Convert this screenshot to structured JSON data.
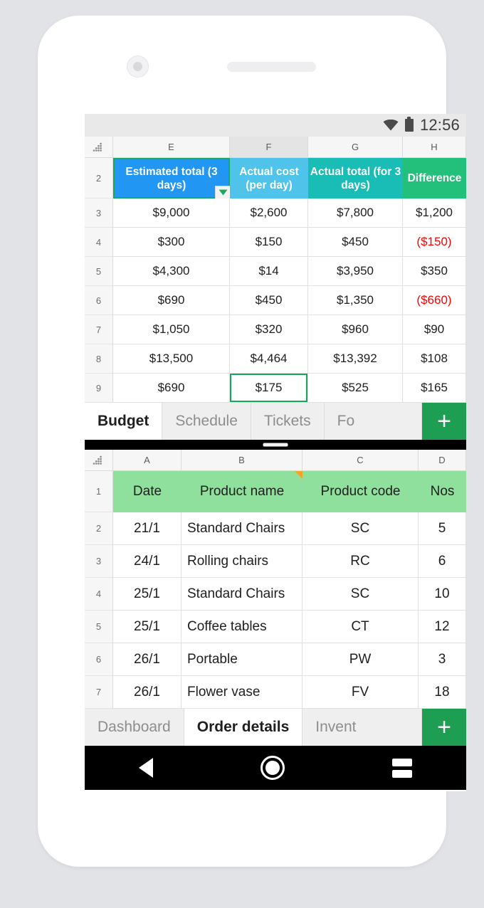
{
  "status_bar": {
    "time": "12:56",
    "wifi_icon": "wifi-icon",
    "battery_icon": "battery-full-icon"
  },
  "colors": {
    "accent_green": "#1e9e52",
    "header_blue": "#2196f3",
    "header_lightblue": "#4fc3e9",
    "header_teal": "#1abdb5",
    "header_green": "#22c07a",
    "row1_green": "#8ee09c",
    "negative_red": "#ff0000",
    "selection_green": "#15a85f",
    "note_flag_orange": "#f5a623"
  },
  "top_sheet": {
    "name": "Budget",
    "corner_icon": "select-all-icon",
    "column_headers": [
      "E",
      "F",
      "G",
      "H"
    ],
    "active_column": "F",
    "header_row_number": "2",
    "header_cells": [
      {
        "text": "Estimated total (3 days)",
        "color": "#2196f3",
        "selected": true
      },
      {
        "text": "Actual cost (per day)",
        "color": "#4fc3e9",
        "selected": false
      },
      {
        "text": "Actual total (for 3 days)",
        "color": "#1abdb5",
        "selected": false
      },
      {
        "text": "Difference",
        "color": "#22c07a",
        "selected": false
      }
    ],
    "rows": [
      {
        "n": "3",
        "cells": [
          {
            "v": "$9,000"
          },
          {
            "v": "$2,600"
          },
          {
            "v": "$7,800"
          },
          {
            "v": "$1,200"
          }
        ]
      },
      {
        "n": "4",
        "cells": [
          {
            "v": "$300"
          },
          {
            "v": "$150"
          },
          {
            "v": "$450"
          },
          {
            "v": "($150)",
            "neg": true
          }
        ]
      },
      {
        "n": "5",
        "cells": [
          {
            "v": "$4,300"
          },
          {
            "v": "$14"
          },
          {
            "v": "$3,950"
          },
          {
            "v": "$350"
          }
        ]
      },
      {
        "n": "6",
        "cells": [
          {
            "v": "$690"
          },
          {
            "v": "$450"
          },
          {
            "v": "$1,350"
          },
          {
            "v": "($660)",
            "neg": true
          }
        ]
      },
      {
        "n": "7",
        "cells": [
          {
            "v": "$1,050"
          },
          {
            "v": "$320"
          },
          {
            "v": "$960"
          },
          {
            "v": "$90"
          }
        ]
      },
      {
        "n": "8",
        "cells": [
          {
            "v": "$13,500"
          },
          {
            "v": "$4,464"
          },
          {
            "v": "$13,392"
          },
          {
            "v": "$108"
          }
        ]
      },
      {
        "n": "9",
        "cells": [
          {
            "v": "$690"
          },
          {
            "v": "$175",
            "sel": true
          },
          {
            "v": "$525"
          },
          {
            "v": "$165"
          }
        ]
      }
    ]
  },
  "top_tabs": {
    "items": [
      {
        "label": "Budget",
        "active": true
      },
      {
        "label": "Schedule",
        "active": false
      },
      {
        "label": "Tickets",
        "active": false
      },
      {
        "label": "Fo",
        "active": false,
        "clipped": true
      }
    ],
    "add_label": "+",
    "add_icon": "plus-icon"
  },
  "bottom_sheet": {
    "name": "Order details",
    "corner_icon": "select-all-icon",
    "column_headers": [
      "A",
      "B",
      "C",
      "D"
    ],
    "header_row_number": "1",
    "header_cells": [
      {
        "text": "Date"
      },
      {
        "text": "Product name",
        "note": true
      },
      {
        "text": "Product code"
      },
      {
        "text": "Nos"
      }
    ],
    "rows": [
      {
        "n": "2",
        "cells": [
          {
            "v": "21/1"
          },
          {
            "v": "Standard Chairs"
          },
          {
            "v": "SC"
          },
          {
            "v": "5"
          }
        ]
      },
      {
        "n": "3",
        "cells": [
          {
            "v": "24/1"
          },
          {
            "v": "Rolling chairs"
          },
          {
            "v": "RC"
          },
          {
            "v": "6"
          }
        ]
      },
      {
        "n": "4",
        "cells": [
          {
            "v": "25/1"
          },
          {
            "v": "Standard Chairs"
          },
          {
            "v": "SC"
          },
          {
            "v": "10"
          }
        ]
      },
      {
        "n": "5",
        "cells": [
          {
            "v": "25/1"
          },
          {
            "v": "Coffee tables"
          },
          {
            "v": "CT"
          },
          {
            "v": "12"
          }
        ]
      },
      {
        "n": "6",
        "cells": [
          {
            "v": "26/1"
          },
          {
            "v": "Portable"
          },
          {
            "v": "PW"
          },
          {
            "v": "3"
          }
        ]
      },
      {
        "n": "7",
        "cells": [
          {
            "v": "26/1"
          },
          {
            "v": "Flower vase"
          },
          {
            "v": "FV"
          },
          {
            "v": "18"
          }
        ]
      }
    ]
  },
  "bottom_tabs": {
    "items": [
      {
        "label": "Dashboard",
        "active": false
      },
      {
        "label": "Order details",
        "active": true
      },
      {
        "label": "Invent",
        "active": false,
        "clipped": true
      }
    ],
    "add_label": "+",
    "add_icon": "plus-icon"
  },
  "nav_bar": {
    "back_icon": "back-triangle-icon",
    "home_icon": "home-circle-icon",
    "recents_icon": "recents-icon"
  }
}
